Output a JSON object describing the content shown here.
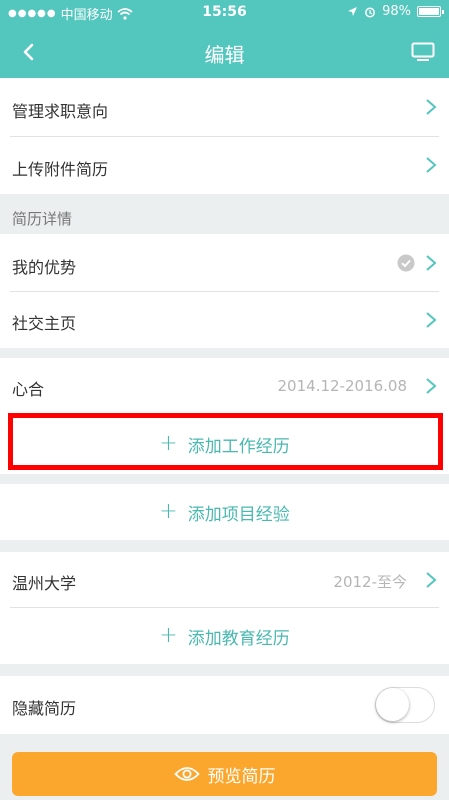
{
  "status_bar": {
    "carrier": "中国移动",
    "time": "15:56",
    "battery": "98%",
    "battery_level": 0.98
  },
  "nav": {
    "title": "编辑",
    "back_icon": "chevron-left-icon",
    "right_icon": "screen-icon"
  },
  "top_items": [
    {
      "label": "管理求职意向"
    },
    {
      "label": "上传附件简历"
    }
  ],
  "resume_details": {
    "section_title": "简历详情",
    "items": [
      {
        "label": "我的优势",
        "status_icon": "check-circle-icon"
      },
      {
        "label": "社交主页"
      }
    ]
  },
  "work": {
    "company": "心合",
    "period": "2014.12-2016.08",
    "add_label": "添加工作经历"
  },
  "project": {
    "add_label": "添加项目经验"
  },
  "education": {
    "school": "温州大学",
    "period": "2012-至今",
    "add_label": "添加教育经历"
  },
  "hide_resume": {
    "label": "隐藏简历",
    "enabled": false
  },
  "preview_button": {
    "label": "预览简历",
    "icon": "eye-icon"
  },
  "colors": {
    "brand": "#53c6bd",
    "accent_text": "#49b9b0",
    "preview": "#fba72d",
    "highlight": "#ff0000"
  }
}
